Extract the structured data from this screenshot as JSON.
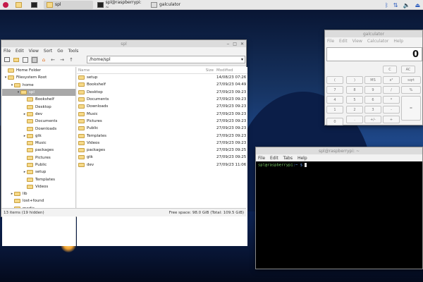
{
  "taskbar": {
    "items": [
      {
        "label": "spl"
      },
      {
        "label": "spl@raspberrypi: ~"
      },
      {
        "label": "galculator"
      }
    ]
  },
  "filemanager": {
    "title": "spl",
    "menu": [
      "File",
      "Edit",
      "View",
      "Sort",
      "Go",
      "Tools"
    ],
    "path": "/home/spl",
    "tree": [
      {
        "label": "Home Folder",
        "indent": 0,
        "arrow": "",
        "selected": false
      },
      {
        "label": "Filesystem Root",
        "indent": 0,
        "arrow": "▾",
        "selected": false
      },
      {
        "label": "home",
        "indent": 1,
        "arrow": "▾",
        "selected": false
      },
      {
        "label": "spl",
        "indent": 2,
        "arrow": "▾",
        "selected": true
      },
      {
        "label": "Bookshelf",
        "indent": 3,
        "arrow": "",
        "selected": false
      },
      {
        "label": "Desktop",
        "indent": 3,
        "arrow": "",
        "selected": false
      },
      {
        "label": "dev",
        "indent": 3,
        "arrow": "▸",
        "selected": false
      },
      {
        "label": "Documents",
        "indent": 3,
        "arrow": "",
        "selected": false
      },
      {
        "label": "Downloads",
        "indent": 3,
        "arrow": "",
        "selected": false
      },
      {
        "label": "gtk",
        "indent": 3,
        "arrow": "▸",
        "selected": false
      },
      {
        "label": "Music",
        "indent": 3,
        "arrow": "",
        "selected": false
      },
      {
        "label": "packages",
        "indent": 3,
        "arrow": "",
        "selected": false
      },
      {
        "label": "Pictures",
        "indent": 3,
        "arrow": "",
        "selected": false
      },
      {
        "label": "Public",
        "indent": 3,
        "arrow": "",
        "selected": false
      },
      {
        "label": "setup",
        "indent": 3,
        "arrow": "▸",
        "selected": false
      },
      {
        "label": "Templates",
        "indent": 3,
        "arrow": "",
        "selected": false
      },
      {
        "label": "Videos",
        "indent": 3,
        "arrow": "",
        "selected": false
      },
      {
        "label": "lib",
        "indent": 1,
        "arrow": "▸",
        "selected": false
      },
      {
        "label": "lost+found",
        "indent": 1,
        "arrow": "",
        "selected": false
      },
      {
        "label": "media",
        "indent": 1,
        "arrow": "",
        "selected": false
      }
    ],
    "columns": {
      "name": "Name",
      "size": "Size",
      "modified": "Modified"
    },
    "files": [
      {
        "name": "setup",
        "modified": "14/08/23 07:26"
      },
      {
        "name": "Bookshelf",
        "modified": "27/09/23 04:49"
      },
      {
        "name": "Desktop",
        "modified": "27/09/23 09:23"
      },
      {
        "name": "Documents",
        "modified": "27/09/23 09:23"
      },
      {
        "name": "Downloads",
        "modified": "27/09/23 09:23"
      },
      {
        "name": "Music",
        "modified": "27/09/23 09:23"
      },
      {
        "name": "Pictures",
        "modified": "27/09/23 09:23"
      },
      {
        "name": "Public",
        "modified": "27/09/23 09:23"
      },
      {
        "name": "Templates",
        "modified": "27/09/23 09:23"
      },
      {
        "name": "Videos",
        "modified": "27/09/23 09:23"
      },
      {
        "name": "packages",
        "modified": "27/09/23 09:25"
      },
      {
        "name": "gtk",
        "modified": "27/09/23 09:25"
      },
      {
        "name": "dev",
        "modified": "27/09/23 11:06"
      }
    ],
    "status_left": "13 items (19 hidden)",
    "status_right": "Free space: 98.0 GiB (Total: 109.5 GiB)"
  },
  "calculator": {
    "title": "galculator",
    "menu": [
      "File",
      "Edit",
      "View",
      "Calculator",
      "Help"
    ],
    "display": "0",
    "buttons": [
      {
        "label": "C"
      },
      {
        "label": "AC"
      },
      {
        "label": "("
      },
      {
        "label": ")"
      },
      {
        "label": "MS"
      },
      {
        "label": "x²"
      },
      {
        "label": "sqrt"
      },
      {
        "label": "7"
      },
      {
        "label": "8"
      },
      {
        "label": "9"
      },
      {
        "label": "/"
      },
      {
        "label": "%"
      },
      {
        "label": "4"
      },
      {
        "label": "5"
      },
      {
        "label": "6"
      },
      {
        "label": "*"
      },
      {
        "label": "="
      },
      {
        "label": "1"
      },
      {
        "label": "2"
      },
      {
        "label": "3"
      },
      {
        "label": "-"
      },
      {
        "label": "0"
      },
      {
        "label": "."
      },
      {
        "label": "+/-"
      },
      {
        "label": "+"
      }
    ]
  },
  "terminal": {
    "title": "spl@raspberrypi: ~",
    "menu": [
      "File",
      "Edit",
      "Tabs",
      "Help"
    ],
    "prompt_user": "spl@raspberrypi",
    "prompt_path": ":~ $"
  }
}
